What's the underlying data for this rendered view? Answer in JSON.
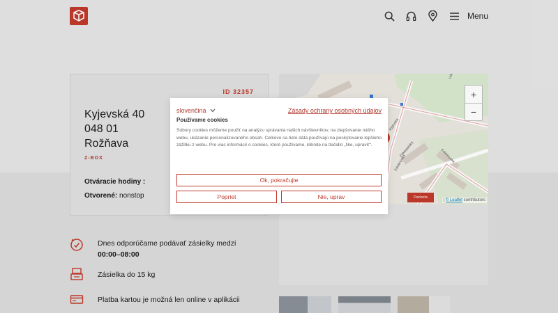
{
  "header": {
    "menu_label": "Menu",
    "icons": [
      "search-icon",
      "headset-icon",
      "location-pin-icon",
      "hamburger-icon"
    ]
  },
  "card": {
    "id": "ID 32357",
    "street": "Kyjevská 40",
    "postal": "048 01",
    "city": "Rožňava",
    "type": "Z-BOX",
    "hours_title": "Otváracie hodiny :",
    "open_label": "Otvorené:",
    "open_value": "nonstop"
  },
  "info": {
    "time_text": "Dnes odporúčame podávať zásielky medzi",
    "time_range": "00:00–08:00",
    "weight_text": "Zásielka do 15 kg",
    "payment_text": "Platba kartou je možná len online v aplikácii"
  },
  "map": {
    "zoom_in": "+",
    "zoom_out": "−",
    "attribution_prefix": "|",
    "attribution_link": "© Leaflet",
    "attribution_suffix": "contributors",
    "badge": "Packeta",
    "streets": [
      "Kyjevská",
      "Edelényska",
      "Zakarpatská",
      "Edelényska",
      "Vršok"
    ]
  },
  "cookie": {
    "language": "slovenčina",
    "policy_link": "Zásady ochrany osobných údajov",
    "title": "Používame cookies",
    "body": "Súbory cookies môžeme použiť na analýzu správania našich návštevníkov, na zlepšovanie nášho webu, ukázanie personalizovaného obsah. Celkovo sa tieto dáta používajú na poskytovanie lepšieho zážitku z webu. Pre viac informácií o cookies, ktoré používame, kliknite na tlačidlo „Nie, upraviť“.",
    "accept": "Ok, pokračujte",
    "deny": "Popriet",
    "adjust": "Nie, uprav"
  },
  "colors": {
    "brand": "#c0392b"
  }
}
